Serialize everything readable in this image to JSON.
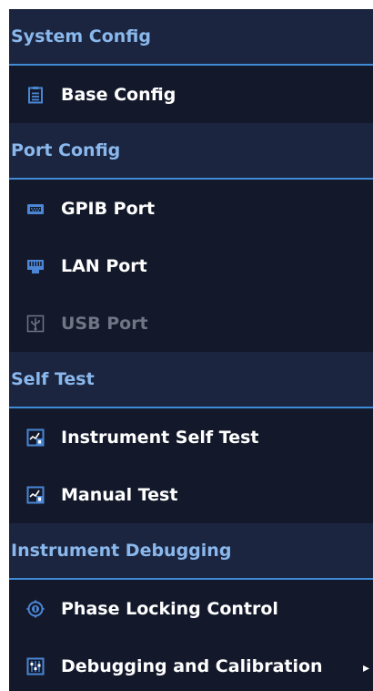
{
  "colors": {
    "panel_bg": "#13192b",
    "header_bg": "#1b2540",
    "header_text": "#8ab8ec",
    "divider": "#3f8bd6",
    "item_text": "#ffffff",
    "disabled_text": "#6e7585",
    "icon_accent": "#4a86d4"
  },
  "sections": [
    {
      "title": "System Config",
      "items": [
        {
          "label": "Base Config",
          "icon": "clipboard-icon",
          "disabled": false
        }
      ]
    },
    {
      "title": "Port Config",
      "items": [
        {
          "label": "GPIB Port",
          "icon": "gpib-connector-icon",
          "disabled": false
        },
        {
          "label": "LAN Port",
          "icon": "lan-port-icon",
          "disabled": false
        },
        {
          "label": "USB Port",
          "icon": "usb-icon",
          "disabled": true
        }
      ]
    },
    {
      "title": "Self Test",
      "items": [
        {
          "label": "Instrument Self Test",
          "icon": "self-test-chart-icon",
          "disabled": false
        },
        {
          "label": "Manual Test",
          "icon": "manual-test-chart-icon",
          "disabled": false
        }
      ]
    },
    {
      "title": "Instrument Debugging",
      "items": [
        {
          "label": "Phase Locking Control",
          "icon": "phase-lock-icon",
          "disabled": false
        },
        {
          "label": "Debugging and Calibration",
          "icon": "calibration-sliders-icon",
          "disabled": false
        }
      ]
    }
  ]
}
